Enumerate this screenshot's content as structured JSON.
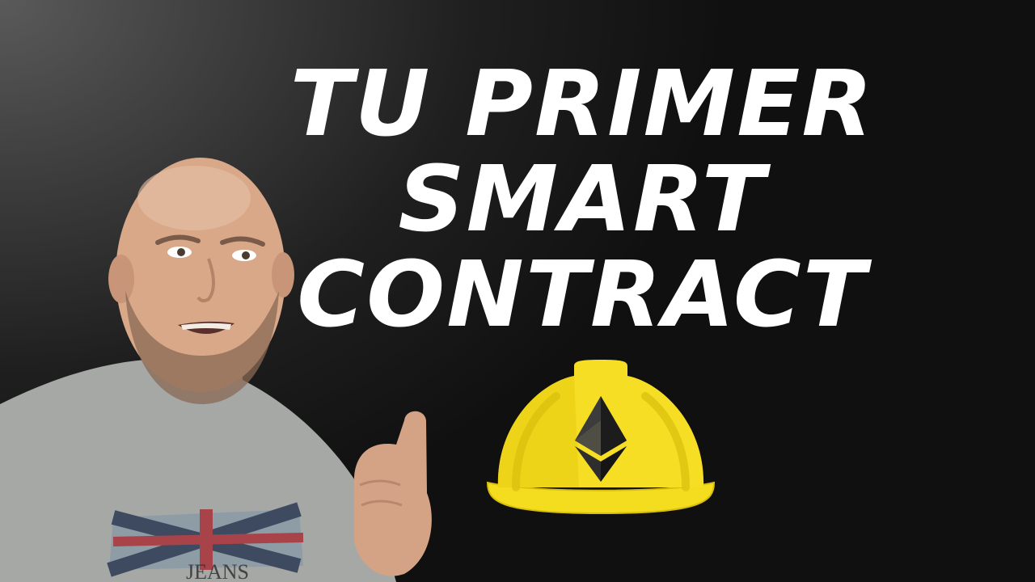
{
  "headline": {
    "line1": "TU PRIMER",
    "line2": "SMART",
    "line3": "CONTRACT"
  },
  "shirt": {
    "print_text": "JEANS"
  },
  "colors": {
    "text": "#ffffff",
    "helmet": "#f4dc1f",
    "helmet_shadow": "#d9bf0d",
    "background_dark": "#101010",
    "background_light": "#5a5a5a",
    "shirt": "#a7a9a6"
  },
  "icons": {
    "helmet": "hard-hat-icon",
    "logo": "ethereum-logo-icon"
  }
}
